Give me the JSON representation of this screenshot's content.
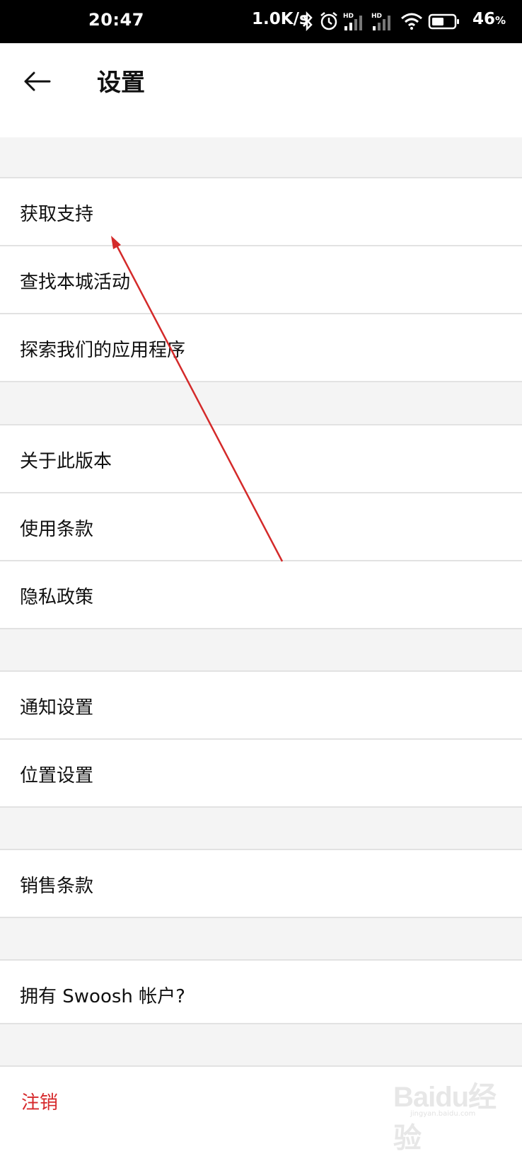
{
  "status_bar": {
    "time": "20:47",
    "net_speed": "1.0K/s",
    "battery_number": "46",
    "battery_unit": "%"
  },
  "app_bar": {
    "title": "设置"
  },
  "menu": {
    "support": "获取支持",
    "local_events": "查找本城活动",
    "explore_apps": "探索我们的应用程序",
    "about_version": "关于此版本",
    "terms_of_use": "使用条款",
    "privacy_policy": "隐私政策",
    "notification_settings": "通知设置",
    "location_settings": "位置设置",
    "terms_of_sale": "销售条款",
    "swoosh_account": "拥有 Swoosh 帐户?",
    "logout": "注销"
  },
  "colors": {
    "logout": "#d6282b",
    "annotation_arrow": "#d42a2a",
    "divider": "#e2e2e2",
    "section_gap": "#f4f4f4"
  },
  "watermark": {
    "text": "Baidu经验",
    "sub": "jingyan.baidu.com"
  }
}
